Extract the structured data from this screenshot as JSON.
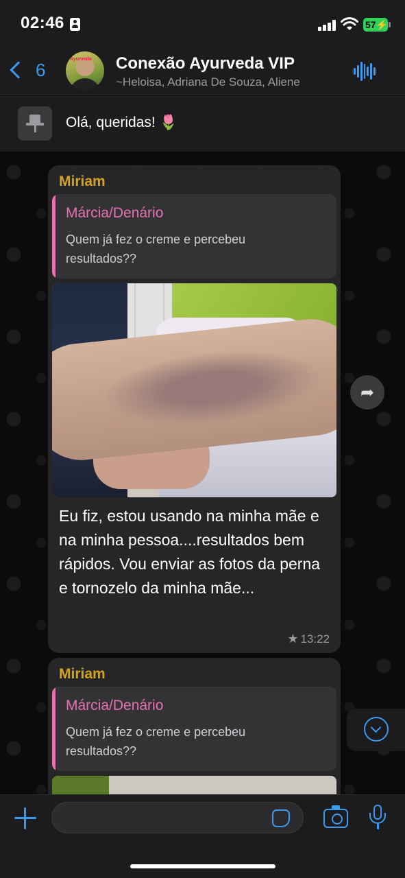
{
  "status_bar": {
    "time": "02:46",
    "battery": "57"
  },
  "header": {
    "back_count": "6",
    "title": "Conexão Ayurveda VIP",
    "members": "~Heloisa, Adriana De Souza, Aliene"
  },
  "pinned": {
    "text": "Olá, queridas! 🌷"
  },
  "messages": [
    {
      "sender": "Miriam",
      "quote_author": "Márcia/Denário",
      "quote_text": "Quem já  fez o creme e percebeu resultados??",
      "text": "Eu fiz, estou usando na minha mãe e na minha pessoa....resultados bem rápidos.  Vou enviar as fotos da perna e tornozelo da minha mãe...",
      "time": "13:22",
      "starred": true
    },
    {
      "sender": "Miriam",
      "quote_author": "Márcia/Denário",
      "quote_text": "Quem já  fez o creme e percebeu resultados??"
    }
  ],
  "input": {
    "placeholder": ""
  },
  "colors": {
    "accent": "#3b9af0",
    "sender": "#d6a319",
    "quote": "#e672b0",
    "battery": "#30d158"
  },
  "icons": [
    "id-card-icon",
    "signal-icon",
    "wifi-icon",
    "battery-icon",
    "back-chevron-icon",
    "voice-wave-icon",
    "pin-icon",
    "forward-icon",
    "star-icon",
    "scroll-down-icon",
    "plus-icon",
    "sticker-icon",
    "camera-icon",
    "microphone-icon"
  ]
}
